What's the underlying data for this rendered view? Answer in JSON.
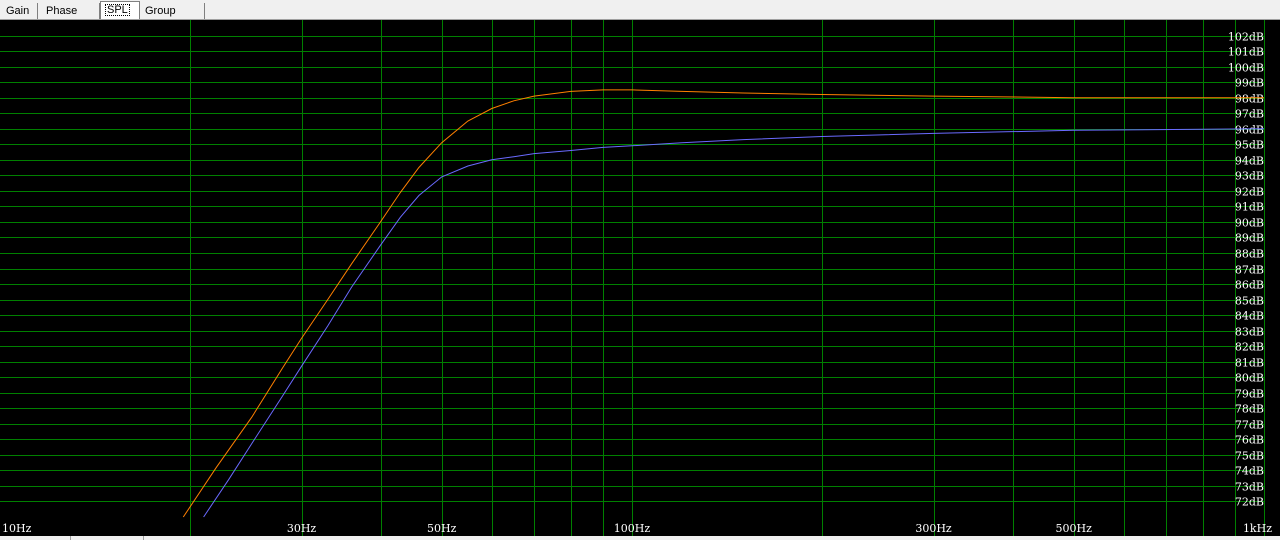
{
  "tabs": [
    {
      "label": "Gain",
      "active": false
    },
    {
      "label": "Phase plot",
      "active": false
    },
    {
      "label": "SPL",
      "active": true
    },
    {
      "label": "Group delay",
      "active": false
    }
  ],
  "chart_data": {
    "type": "line",
    "title": "",
    "xlabel": "",
    "ylabel": "",
    "x_scale": "log",
    "xlim": [
      10,
      1000
    ],
    "ylim": [
      71,
      103
    ],
    "grid": true,
    "background": "#000000",
    "grid_color": "#008000",
    "label_color": "#ffffff",
    "x_tick_labels": [
      {
        "value": 10,
        "label": "10Hz"
      },
      {
        "value": 30,
        "label": "30Hz"
      },
      {
        "value": 50,
        "label": "50Hz"
      },
      {
        "value": 100,
        "label": "100Hz"
      },
      {
        "value": 300,
        "label": "300Hz"
      },
      {
        "value": 500,
        "label": "500Hz"
      },
      {
        "value": 1000,
        "label": "1kHz"
      }
    ],
    "x_grid": [
      20,
      30,
      40,
      50,
      60,
      70,
      80,
      90,
      100,
      200,
      300,
      400,
      500,
      600,
      700,
      800,
      900
    ],
    "y_ticks": [
      {
        "value": 102,
        "label": "102dB"
      },
      {
        "value": 101,
        "label": "101dB"
      },
      {
        "value": 100,
        "label": "100dB"
      },
      {
        "value": 99,
        "label": "99dB"
      },
      {
        "value": 98,
        "label": "98dB"
      },
      {
        "value": 97,
        "label": "97dB"
      },
      {
        "value": 96,
        "label": "96dB"
      },
      {
        "value": 95,
        "label": "95dB"
      },
      {
        "value": 94,
        "label": "94dB"
      },
      {
        "value": 93,
        "label": "93dB"
      },
      {
        "value": 92,
        "label": "92dB"
      },
      {
        "value": 91,
        "label": "91dB"
      },
      {
        "value": 90,
        "label": "90dB"
      },
      {
        "value": 89,
        "label": "89dB"
      },
      {
        "value": 88,
        "label": "88dB"
      },
      {
        "value": 87,
        "label": "87dB"
      },
      {
        "value": 86,
        "label": "86dB"
      },
      {
        "value": 85,
        "label": "85dB"
      },
      {
        "value": 84,
        "label": "84dB"
      },
      {
        "value": 83,
        "label": "83dB"
      },
      {
        "value": 82,
        "label": "82dB"
      },
      {
        "value": 81,
        "label": "81dB"
      },
      {
        "value": 80,
        "label": "80dB"
      },
      {
        "value": 79,
        "label": "79dB"
      },
      {
        "value": 78,
        "label": "78dB"
      },
      {
        "value": 77,
        "label": "77dB"
      },
      {
        "value": 76,
        "label": "76dB"
      },
      {
        "value": 75,
        "label": "75dB"
      },
      {
        "value": 74,
        "label": "74dB"
      },
      {
        "value": 73,
        "label": "73dB"
      },
      {
        "value": 72,
        "label": "72dB"
      }
    ],
    "series": [
      {
        "color": "#ff8000",
        "x": [
          19.5,
          22,
          25,
          28,
          30,
          33,
          36,
          40,
          43,
          46,
          50,
          55,
          60,
          65,
          70,
          80,
          90,
          100,
          120,
          150,
          200,
          300,
          500,
          1000
        ],
        "y": [
          71,
          74.2,
          77.4,
          80.6,
          82.5,
          85.0,
          87.3,
          90.0,
          91.9,
          93.5,
          95.1,
          96.5,
          97.3,
          97.8,
          98.1,
          98.4,
          98.5,
          98.5,
          98.4,
          98.3,
          98.2,
          98.1,
          98.0,
          98.0
        ]
      },
      {
        "color": "#6a6aff",
        "x": [
          21,
          23,
          25,
          28,
          30,
          33,
          36,
          40,
          43,
          46,
          50,
          55,
          60,
          65,
          70,
          80,
          90,
          100,
          120,
          150,
          200,
          300,
          500,
          1000
        ],
        "y": [
          71,
          73.4,
          75.7,
          78.8,
          80.7,
          83.3,
          85.8,
          88.5,
          90.3,
          91.7,
          92.9,
          93.6,
          94.0,
          94.2,
          94.4,
          94.6,
          94.8,
          94.9,
          95.1,
          95.3,
          95.5,
          95.7,
          95.9,
          96.0
        ]
      }
    ]
  }
}
